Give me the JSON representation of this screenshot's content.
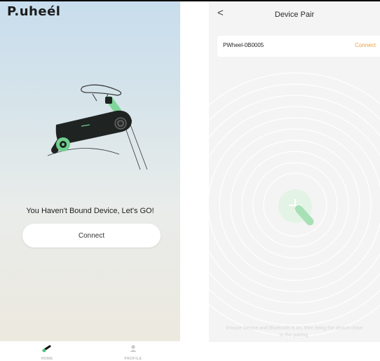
{
  "home": {
    "logo": "P.uheél",
    "empty_message": "You Haven't Bound Device, Let's GO!",
    "connect_label": "Connect",
    "tabs": [
      {
        "label": "HOME",
        "icon": "bike-icon"
      },
      {
        "label": "PROFILE",
        "icon": "user-icon"
      }
    ]
  },
  "pair": {
    "back": "<",
    "title": "Device Pair",
    "device": {
      "name": "PWheel-0B0005",
      "action": "Connect"
    },
    "hint_line1": "Ensure Device and Bluetooth is on, then bring the device close",
    "hint_line2": "to the pairing.",
    "colors": {
      "accent": "#f0a040",
      "green": "#6fcf8f"
    }
  }
}
